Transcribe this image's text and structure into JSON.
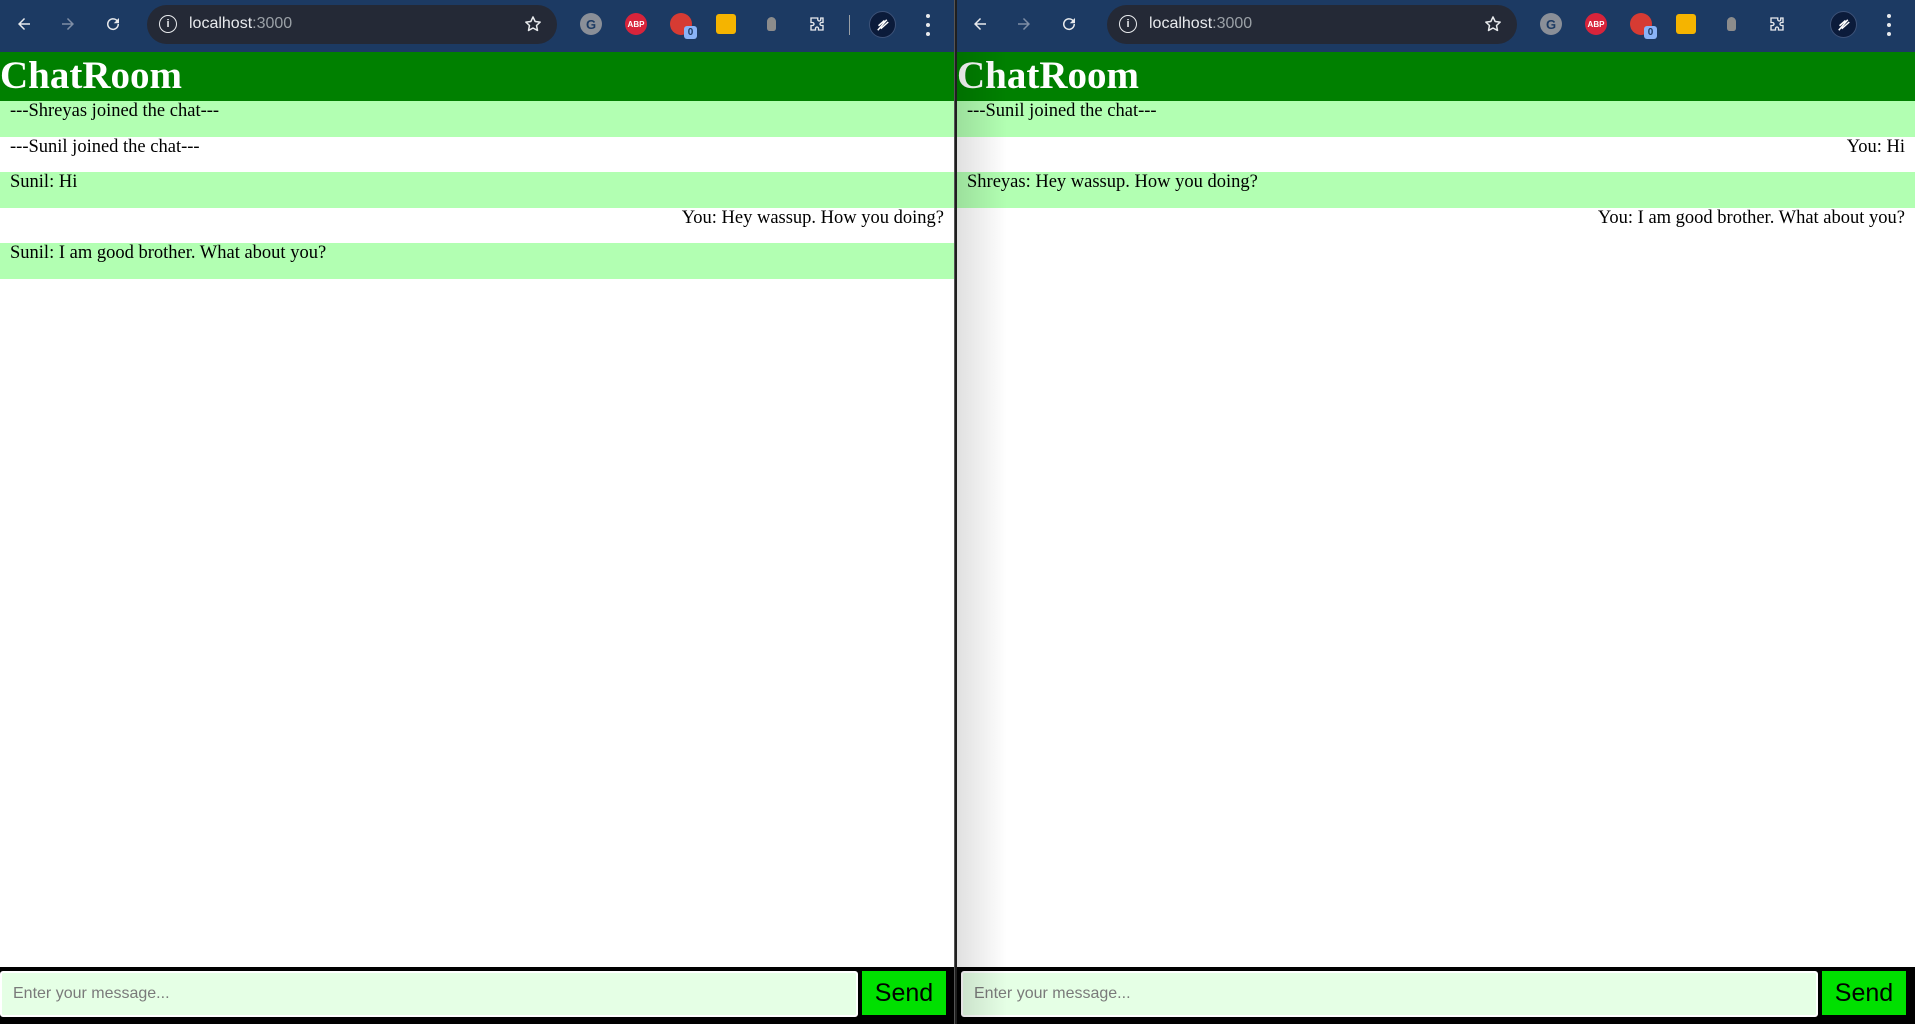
{
  "browser": {
    "url_host": "localhost",
    "url_port": ":3000",
    "extensions": [
      "grammarly-icon",
      "adblock-plus-icon",
      "red-extension-icon",
      "keep-icon",
      "bulb-icon",
      "puzzle-extensions-icon"
    ],
    "abp_label": "ABP",
    "badge_count": "0",
    "g_label": "G"
  },
  "left": {
    "title": "ChatRoom",
    "messages": [
      {
        "text": "---Shreyas joined the chat---"
      },
      {
        "text": "---Sunil joined the chat---"
      },
      {
        "text": "Sunil: Hi"
      },
      {
        "text": "You: Hey wassup. How you doing?"
      },
      {
        "text": "Sunil: I am good brother. What about you?"
      }
    ],
    "input_placeholder": "Enter your message...",
    "send_label": "Send"
  },
  "right": {
    "title": "ChatRoom",
    "messages": [
      {
        "text": "---Sunil joined the chat---"
      },
      {
        "text": "You: Hi"
      },
      {
        "text": "Shreyas: Hey wassup. How you doing?"
      },
      {
        "text": "You: I am good brother. What about you?"
      }
    ],
    "input_placeholder": "Enter your message...",
    "send_label": "Send"
  },
  "colors": {
    "header_green": "#008000",
    "row_green": "#b2ffb2",
    "send_green": "#00e000",
    "input_bg": "#e5ffe5",
    "toolbar_bg": "#1c3a63"
  }
}
